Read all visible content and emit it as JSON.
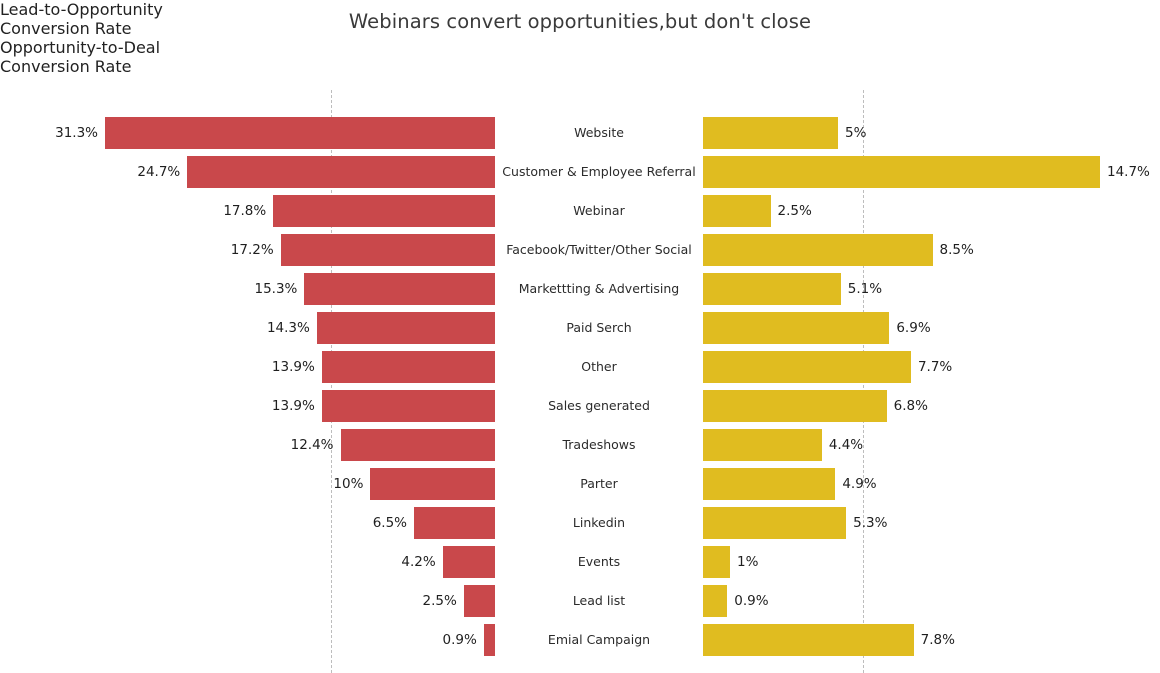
{
  "chart_data": {
    "type": "bar",
    "title": "Webinars convert opportunities,but don't close",
    "orientation": "horizontal",
    "layout": "butterfly-tornado-dual-panel",
    "grid": true,
    "gridlines": [
      {
        "panel": "left",
        "style": "dashed",
        "color": "#bdbdbd"
      },
      {
        "panel": "right",
        "style": "dashed",
        "color": "#bdbdbd"
      }
    ],
    "legend": "none",
    "categories": [
      "Website",
      "Customer & Employee Referral",
      "Webinar",
      "Facebook/Twitter/Other Social",
      "Markettting & Advertising",
      "Paid Serch",
      "Other",
      "Sales generated",
      "Tradeshows",
      "Parter",
      "Linkedin",
      "Events",
      "Lead list",
      "Emial Campaign"
    ],
    "series": [
      {
        "name": "Lead-to-Opportunity Conversion Rate",
        "panel": "left",
        "color": "#c9484b",
        "unit": "%",
        "values": [
          31.3,
          24.7,
          17.8,
          17.2,
          15.3,
          14.3,
          13.9,
          13.9,
          12.4,
          10,
          6.5,
          4.2,
          2.5,
          0.9
        ],
        "labels": [
          "31.3%",
          "24.7%",
          "17.8%",
          "17.2%",
          "15.3%",
          "14.3%",
          "13.9%",
          "13.9%",
          "12.4%",
          "10%",
          "6.5%",
          "4.2%",
          "2.5%",
          "0.9%"
        ],
        "xlim": [
          0,
          31.3
        ]
      },
      {
        "name": "Opportunity-to-Deal Conversion Rate",
        "panel": "right",
        "color": "#e0bc20",
        "unit": "%",
        "values": [
          5,
          14.7,
          2.5,
          8.5,
          5.1,
          6.9,
          7.7,
          6.8,
          4.4,
          4.9,
          5.3,
          1,
          0.9,
          7.8
        ],
        "labels": [
          "5%",
          "14.7%",
          "2.5%",
          "8.5%",
          "5.1%",
          "6.9%",
          "7.7%",
          "6.8%",
          "4.4%",
          "4.9%",
          "5.3%",
          "1%",
          "0.9%",
          "7.8%"
        ],
        "xlim": [
          0,
          14.7
        ]
      }
    ],
    "xlabel": "",
    "ylabel": ""
  },
  "panels": {
    "left": {
      "header_line1": "Lead-to-Opportunity",
      "header_line2": "Conversion Rate"
    },
    "right": {
      "header_line1": "Opportunity-to-Deal",
      "header_line2": "Conversion Rate"
    }
  },
  "colors": {
    "left_bar": "#c9484b",
    "right_bar": "#e0bc20",
    "background": "#ffffff",
    "text": "#222222",
    "gridline": "#bdbdbd"
  }
}
